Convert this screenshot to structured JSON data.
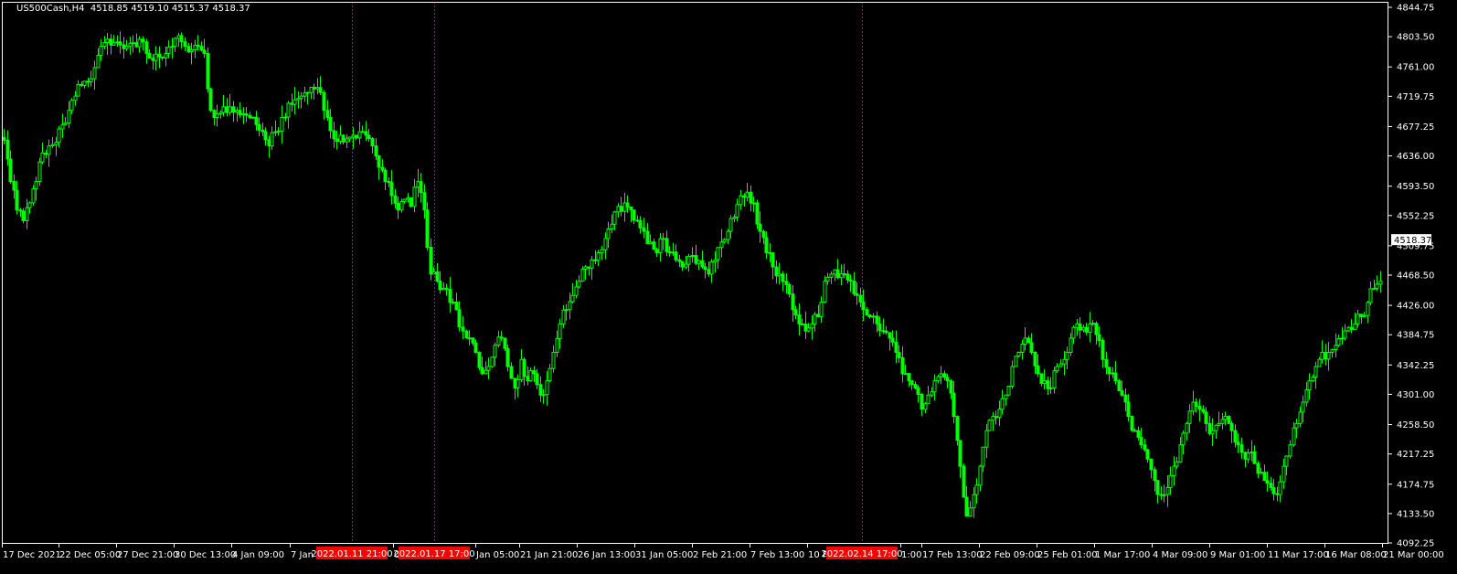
{
  "header": {
    "symbol_line": "US500Cash,H4  4518.85 4519.10 4515.37 4518.37"
  },
  "colors": {
    "background": "#000000",
    "candle": "#00ff00",
    "axis": "#ffffff",
    "vline": "#ff0000",
    "price_tag_bg": "#ffffff",
    "price_tag_text": "#000000"
  },
  "chart_data": {
    "type": "candlestick",
    "timeframe": "H4",
    "symbol": "US500Cash",
    "ohlc_last": {
      "open": 4518.85,
      "high": 4519.1,
      "low": 4515.37,
      "close": 4518.37
    },
    "current_price_label": "4518.37",
    "ylim": [
      4092.25,
      4844.75
    ],
    "y_ticks": [
      "4844.75",
      "4803.50",
      "4761.00",
      "4719.75",
      "4677.25",
      "4636.00",
      "4593.50",
      "4552.25",
      "4509.75",
      "4468.50",
      "4426.00",
      "4384.75",
      "4342.25",
      "4301.00",
      "4258.50",
      "4217.25",
      "4174.75",
      "4133.50",
      "4092.25"
    ],
    "x_ticks": [
      "17 Dec 2021",
      "22 Dec 05:00",
      "27 Dec 21:00",
      "30 Dec 13:00",
      "4 Jan 09:00",
      "7 Jan 0",
      "00",
      "Jan 05:00",
      "21 Jan 21:00",
      "26 Jan 13:00",
      "31 Jan 05:00",
      "2 Feb 21:00",
      "7 Feb 13:00",
      "10 F",
      "1:00",
      "17 Feb 13:00",
      "22 Feb 09:00",
      "25 Feb 01:00",
      "1 Mar 17:00",
      "4 Mar 09:00",
      "9 Mar 01:00",
      "11 Mar 17:00",
      "16 Mar 08:00",
      "21 Mar 00:00"
    ],
    "vertical_markers": [
      {
        "label": "2022.01.11 21:00"
      },
      {
        "label": "2022.01.17 17:00"
      },
      {
        "label": "2022.02.14 17:00"
      }
    ],
    "close_path": [
      4658,
      4600,
      4560,
      4545,
      4570,
      4600,
      4640,
      4650,
      4655,
      4680,
      4700,
      4720,
      4735,
      4740,
      4760,
      4790,
      4800,
      4795,
      4792,
      4790,
      4795,
      4800,
      4780,
      4770,
      4775,
      4780,
      4790,
      4805,
      4790,
      4785,
      4790,
      4780,
      4700,
      4695,
      4705,
      4705,
      4700,
      4695,
      4690,
      4680,
      4670,
      4650,
      4670,
      4690,
      4710,
      4715,
      4720,
      4725,
      4730,
      4725,
      4690,
      4660,
      4665,
      4660,
      4665,
      4670,
      4665,
      4650,
      4620,
      4600,
      4580,
      4560,
      4575,
      4565,
      4600,
      4560,
      4470,
      4460,
      4450,
      4430,
      4420,
      4390,
      4380,
      4360,
      4330,
      4340,
      4370,
      4380,
      4340,
      4310,
      4350,
      4320,
      4330,
      4300,
      4320,
      4360,
      4400,
      4420,
      4440,
      4460,
      4480,
      4490,
      4500,
      4520,
      4540,
      4565,
      4570,
      4560,
      4545,
      4530,
      4515,
      4500,
      4520,
      4500,
      4490,
      4480,
      4495,
      4485,
      4480,
      4470,
      4490,
      4515,
      4530,
      4550,
      4580,
      4585,
      4570,
      4530,
      4500,
      4480,
      4470,
      4455,
      4420,
      4400,
      4390,
      4400,
      4410,
      4460,
      4470,
      4465,
      4470,
      4460,
      4440,
      4420,
      4410,
      4400,
      4390,
      4380,
      4360,
      4330,
      4320,
      4310,
      4280,
      4300,
      4320,
      4330,
      4320,
      4270,
      4200,
      4130,
      4160,
      4200,
      4250,
      4270,
      4280,
      4300,
      4340,
      4360,
      4380,
      4360,
      4330,
      4320,
      4310,
      4340,
      4350,
      4380,
      4400,
      4395,
      4400,
      4385,
      4350,
      4330,
      4320,
      4300,
      4270,
      4250,
      4230,
      4210,
      4180,
      4160,
      4170,
      4200,
      4230,
      4260,
      4290,
      4280,
      4260,
      4250,
      4260,
      4270,
      4250,
      4230,
      4210,
      4220,
      4190,
      4180,
      4170,
      4160,
      4200,
      4230,
      4260,
      4290,
      4320,
      4340,
      4360,
      4360,
      4370,
      4380,
      4395,
      4400,
      4410,
      4430,
      4450,
      4460
    ]
  }
}
